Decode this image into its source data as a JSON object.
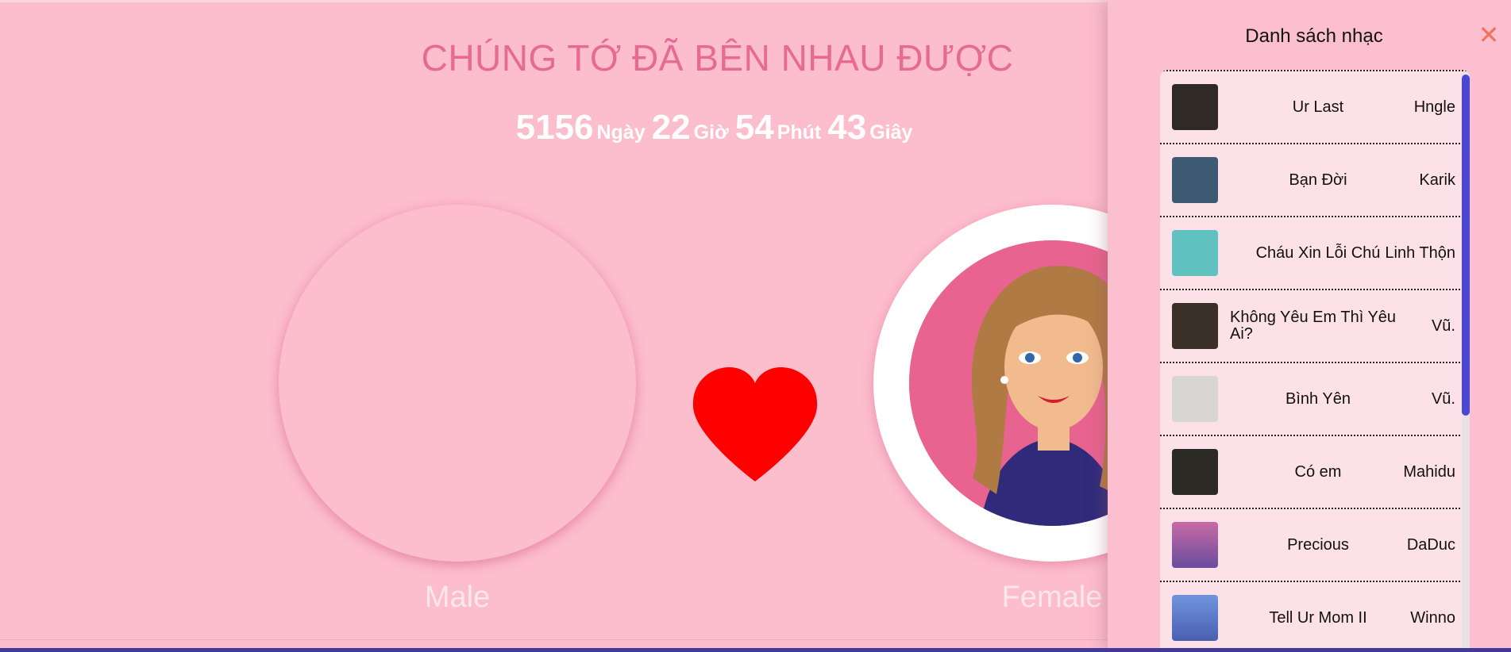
{
  "header": {
    "title": "CHÚNG TỚ ĐÃ BÊN NHAU ĐƯỢC"
  },
  "counter": {
    "days": "5156",
    "days_unit": "Ngày",
    "hours": "22",
    "hours_unit": "Giờ",
    "minutes": "54",
    "minutes_unit": "Phút",
    "seconds": "43",
    "seconds_unit": "Giây"
  },
  "couple": {
    "male_label": "Male",
    "female_label": "Female"
  },
  "playlist": {
    "title": "Danh sách nhạc",
    "close_icon": "✕",
    "items": [
      {
        "song": "Ur Last",
        "artist": "Hngle",
        "thumb_color": "#2f2a26"
      },
      {
        "song": "Bạn Đời",
        "artist": "Karik",
        "thumb_color": "#3e5a72"
      },
      {
        "song": "Cháu Xin Lỗi Chú",
        "artist": "Linh Thộn",
        "thumb_color": "#5fc2bf"
      },
      {
        "song": "Không Yêu Em Thì Yêu Ai?",
        "artist": "Vũ.",
        "thumb_color": "#3a3028"
      },
      {
        "song": "Bình Yên",
        "artist": "Vũ.",
        "thumb_color": "#d8d6d2"
      },
      {
        "song": "Có em",
        "artist": "Mahidu",
        "thumb_color": "#2b2a24"
      },
      {
        "song": "Precious",
        "artist": "DaDuc",
        "thumb_color": "#a75aa8"
      },
      {
        "song": "Tell Ur Mom II",
        "artist": "Winno",
        "thumb_color": "#5a7fc8"
      }
    ]
  },
  "colors": {
    "background": "#fcbdcd",
    "title": "#e66b94",
    "heart": "#ff0000",
    "scroll_thumb": "#4a47d4",
    "close": "#f2715b"
  }
}
